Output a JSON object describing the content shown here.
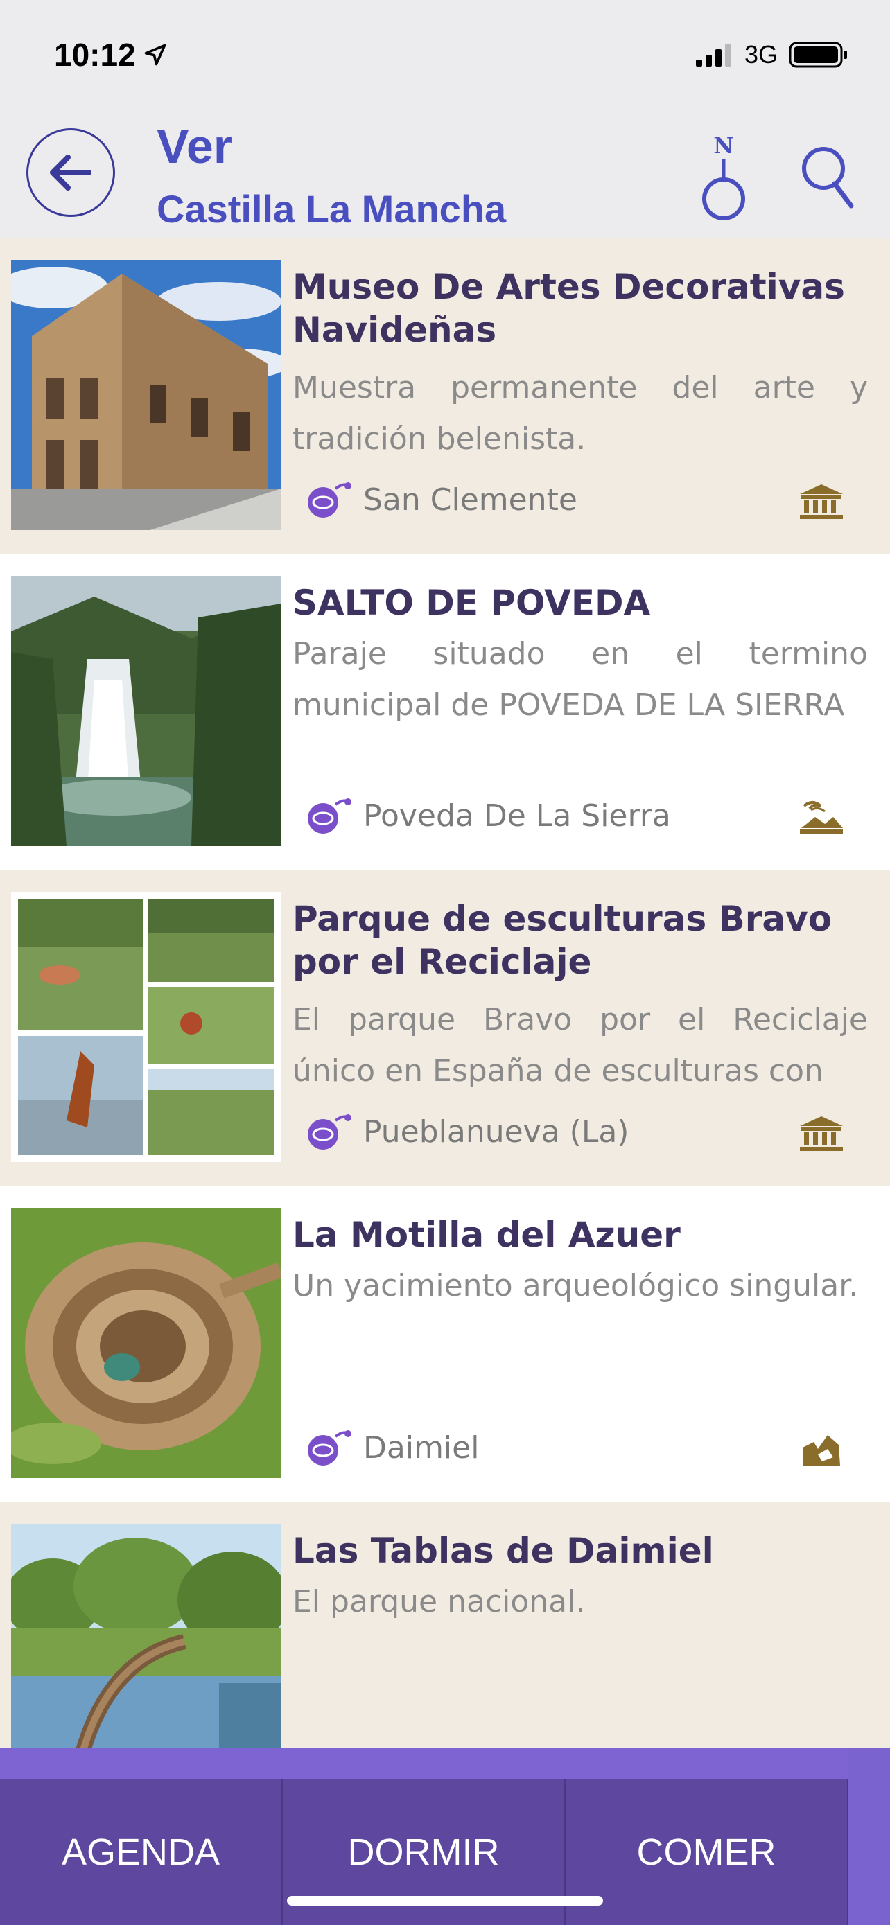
{
  "status_bar": {
    "time": "10:12",
    "network": "3G"
  },
  "header": {
    "title": "Ver",
    "subtitle": "Castilla La Mancha",
    "compass_letter": "N"
  },
  "items": [
    {
      "title": "Museo De Artes Decorativas Navideñas",
      "description": "Muestra permanente del arte y tradición belenista.",
      "town": "San Clemente",
      "category_icon": "museum-icon"
    },
    {
      "title": "SALTO DE POVEDA",
      "description": "Paraje situado en el termino municipal de POVEDA DE LA SIERRA",
      "town": "Poveda De La Sierra",
      "category_icon": "nature-icon"
    },
    {
      "title": "Parque de esculturas Bravo por el Reciclaje",
      "description": "El parque Bravo por el Reciclaje único en España de esculturas con",
      "town": "Pueblanueva (La)",
      "category_icon": "museum-icon"
    },
    {
      "title": "La Motilla del Azuer",
      "description": "Un yacimiento arqueológico singular.",
      "town": "Daimiel",
      "category_icon": "archaeology-icon"
    },
    {
      "title": "Las Tablas de Daimiel",
      "description": "El parque nacional.",
      "town": "",
      "category_icon": ""
    }
  ],
  "bottom_nav": {
    "items": [
      "AGENDA",
      "DORMIR",
      "COMER"
    ]
  },
  "colors": {
    "accent": "#4a4fc0",
    "title_text": "#3e3260",
    "item_beige": "#f1ebe1",
    "nav_bg": "#5d479f",
    "icon_gold": "#8a6d2b"
  }
}
